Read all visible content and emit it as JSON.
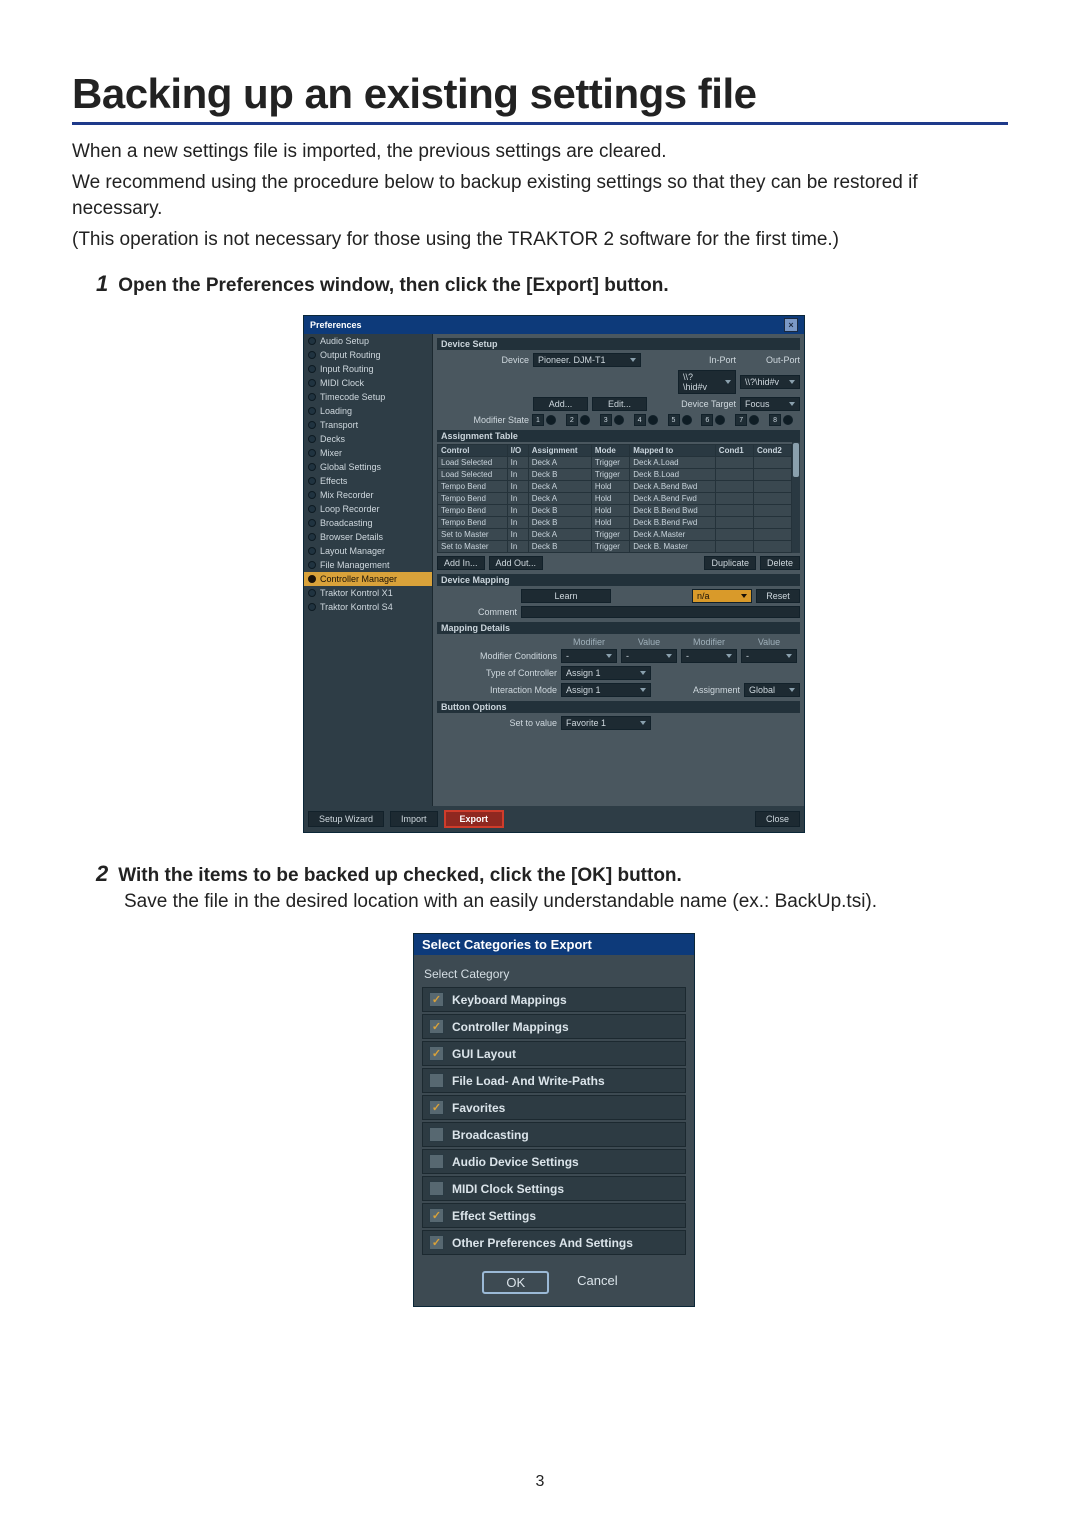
{
  "page": {
    "number": "3"
  },
  "title": "Backing up an existing settings file",
  "intro": {
    "p1": "When a new settings file is imported, the previous settings are cleared.",
    "p2": "We recommend using the procedure below to backup existing settings so that they can be restored if necessary.",
    "p3": "(This operation is not necessary for those using the TRAKTOR 2 software for the first time.)"
  },
  "step1": {
    "num": "1",
    "title": "Open the Preferences window, then click the [Export] button."
  },
  "step2": {
    "num": "2",
    "title": "With the items to be backed up checked, click the [OK] button.",
    "body": "Save the file in the desired location with an easily understandable name (ex.: BackUp.tsi)."
  },
  "prefs": {
    "windowTitle": "Preferences",
    "close": "×",
    "sidebar": [
      "Audio Setup",
      "Output Routing",
      "Input Routing",
      "MIDI Clock",
      "Timecode Setup",
      "Loading",
      "Transport",
      "Decks",
      "Mixer",
      "Global Settings",
      "Effects",
      "Mix Recorder",
      "Loop Recorder",
      "Broadcasting",
      "Browser Details",
      "Layout Manager",
      "File Management",
      "Controller Manager",
      "Traktor Kontrol X1",
      "Traktor Kontrol S4"
    ],
    "sidebarSelectedIndex": 17,
    "sections": {
      "deviceSetup": "Device Setup",
      "assignmentTable": "Assignment Table",
      "deviceMapping": "Device Mapping",
      "mappingDetails": "Mapping Details",
      "buttonOptions": "Button Options"
    },
    "labels": {
      "device": "Device",
      "inPort": "In-Port",
      "outPort": "Out-Port",
      "add": "Add...",
      "edit": "Edit...",
      "deviceTarget": "Device Target",
      "focus": "Focus",
      "modifierState": "Modifier State",
      "addIn": "Add In...",
      "addOut": "Add Out...",
      "duplicate": "Duplicate",
      "delete": "Delete",
      "learn": "Learn",
      "reset": "Reset",
      "na": "n/a",
      "comment": "Comment",
      "modifier": "Modifier",
      "value": "Value",
      "modifierConditions": "Modifier Conditions",
      "typeOfController": "Type of Controller",
      "interactionMode": "Interaction Mode",
      "assignment": "Assignment",
      "global": "Global",
      "assign1": "Assign 1",
      "assign1b": "Assign 1",
      "setToValue": "Set to value",
      "favorite1": "Favorite 1",
      "dash": "-"
    },
    "deviceName": "Pioneer. DJM-T1",
    "inPortVal": "\\\\?\\hid#v",
    "outPortVal": "\\\\?\\hid#v",
    "modifierNums": [
      "1",
      "2",
      "3",
      "4",
      "5",
      "6",
      "7",
      "8"
    ],
    "assignCols": [
      "Control",
      "I/O",
      "Assignment",
      "Mode",
      "Mapped to",
      "Cond1",
      "Cond2"
    ],
    "assignRows": [
      [
        "Load Selected",
        "In",
        "Deck A",
        "Trigger",
        "Deck A.Load",
        "",
        ""
      ],
      [
        "Load Selected",
        "In",
        "Deck B",
        "Trigger",
        "Deck B.Load",
        "",
        ""
      ],
      [
        "Tempo Bend",
        "In",
        "Deck A",
        "Hold",
        "Deck A.Bend Bwd",
        "",
        ""
      ],
      [
        "Tempo Bend",
        "In",
        "Deck A",
        "Hold",
        "Deck A.Bend Fwd",
        "",
        ""
      ],
      [
        "Tempo Bend",
        "In",
        "Deck B",
        "Hold",
        "Deck B.Bend Bwd",
        "",
        ""
      ],
      [
        "Tempo Bend",
        "In",
        "Deck B",
        "Hold",
        "Deck B.Bend Fwd",
        "",
        ""
      ],
      [
        "Set to Master",
        "In",
        "Deck A",
        "Trigger",
        "Deck A.Master",
        "",
        ""
      ],
      [
        "Set to Master",
        "In",
        "Deck B",
        "Trigger",
        "Deck B. Master",
        "",
        ""
      ]
    ],
    "footer": {
      "setupWizard": "Setup Wizard",
      "import": "Import",
      "export": "Export",
      "close": "Close"
    }
  },
  "exportDlg": {
    "title": "Select Categories to Export",
    "sub": "Select Category",
    "items": [
      {
        "label": "Keyboard Mappings",
        "checked": true
      },
      {
        "label": "Controller Mappings",
        "checked": true
      },
      {
        "label": "GUI Layout",
        "checked": true
      },
      {
        "label": "File Load- And Write-Paths",
        "checked": false
      },
      {
        "label": "Favorites",
        "checked": true
      },
      {
        "label": "Broadcasting",
        "checked": false
      },
      {
        "label": "Audio Device Settings",
        "checked": false
      },
      {
        "label": "MIDI Clock Settings",
        "checked": false
      },
      {
        "label": "Effect Settings",
        "checked": true
      },
      {
        "label": "Other Preferences And Settings",
        "checked": true
      }
    ],
    "ok": "OK",
    "cancel": "Cancel"
  }
}
